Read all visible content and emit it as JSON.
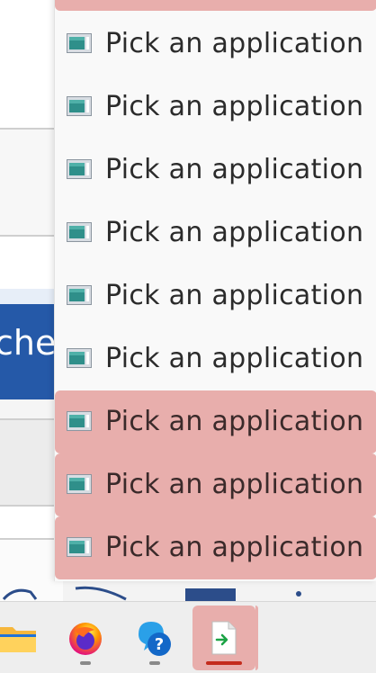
{
  "background_window": {
    "visible_text": "che",
    "accent_color": "#2559a8"
  },
  "jumplist": {
    "highlight_color": "#e8aeac",
    "items": [
      {
        "label": "Pick an application",
        "icon": "app-window-icon",
        "highlighted": false
      },
      {
        "label": "Pick an application",
        "icon": "app-window-icon",
        "highlighted": false
      },
      {
        "label": "Pick an application",
        "icon": "app-window-icon",
        "highlighted": false
      },
      {
        "label": "Pick an application",
        "icon": "app-window-icon",
        "highlighted": false
      },
      {
        "label": "Pick an application",
        "icon": "app-window-icon",
        "highlighted": false
      },
      {
        "label": "Pick an application",
        "icon": "app-window-icon",
        "highlighted": false
      },
      {
        "label": "Pick an application",
        "icon": "app-window-icon",
        "highlighted": true
      },
      {
        "label": "Pick an application",
        "icon": "app-window-icon",
        "highlighted": true
      },
      {
        "label": "Pick an application",
        "icon": "app-window-icon",
        "highlighted": true
      }
    ]
  },
  "taskbar": {
    "apps": [
      {
        "icon": "file-explorer-icon",
        "running": false,
        "active": false
      },
      {
        "icon": "firefox-icon",
        "running": true,
        "active": false
      },
      {
        "icon": "get-help-icon",
        "running": true,
        "active": false
      },
      {
        "icon": "open-with-app-icon",
        "running": true,
        "active": true
      }
    ]
  }
}
